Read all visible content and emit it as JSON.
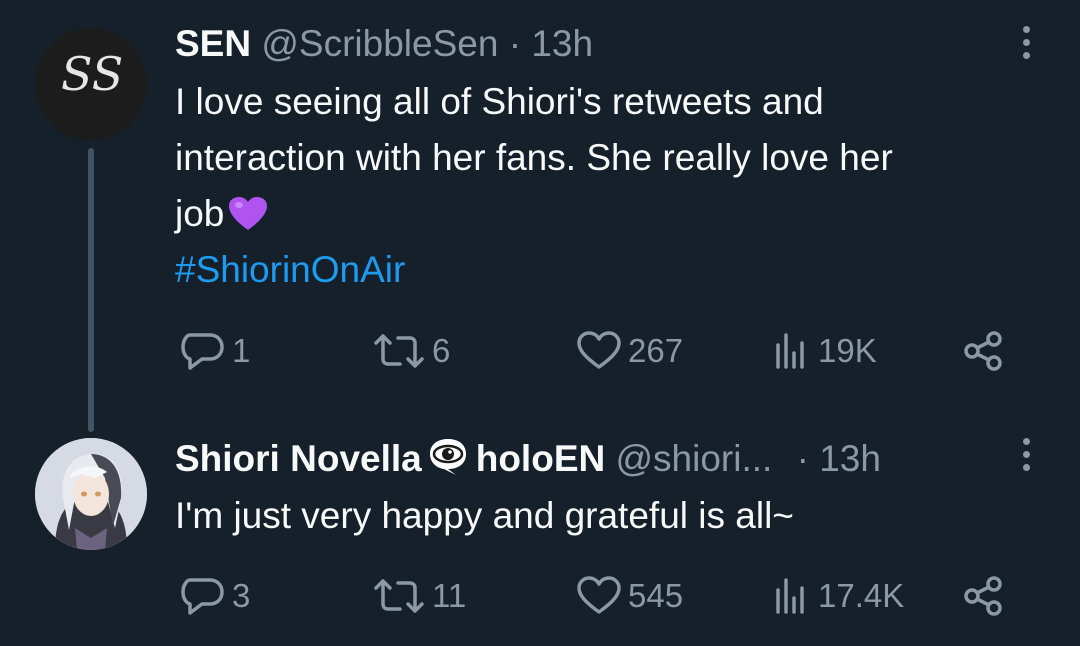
{
  "tweets": [
    {
      "name": "SEN",
      "handle": "@ScribbleSen",
      "time": "· 13h",
      "avatar_text": "SS",
      "text_lines": [
        "I love seeing all of Shiori's retweets  and",
        "interaction with her fans. She really love her",
        "job"
      ],
      "hashtag": "#ShiorinOnAir",
      "stats": {
        "replies": "1",
        "retweets": "6",
        "likes": "267",
        "views": "19K"
      }
    },
    {
      "name": "Shiori Novella",
      "affiliation": "holoEN",
      "handle": "@shiori...",
      "time": "· 13h",
      "text": "I'm just very happy and grateful is all~",
      "stats": {
        "replies": "3",
        "retweets": "11",
        "likes": "545",
        "views": "17.4K"
      }
    }
  ],
  "icons": {
    "reply": "speech-bubble-icon",
    "retweet": "retweet-arrows-icon",
    "like": "heart-outline-icon",
    "views": "bar-chart-icon",
    "share": "share-nodes-icon",
    "more": "vertical-ellipsis-icon",
    "emoji": "purple-heart-emoji",
    "badge": "eye-speech-bubble-emoji"
  },
  "colors": {
    "background": "#15202b",
    "text": "#f7f9f9",
    "muted": "#8b98a5",
    "link": "#1d9bf0",
    "thread_line": "#425364",
    "emoji_heart": "#b054f0"
  }
}
